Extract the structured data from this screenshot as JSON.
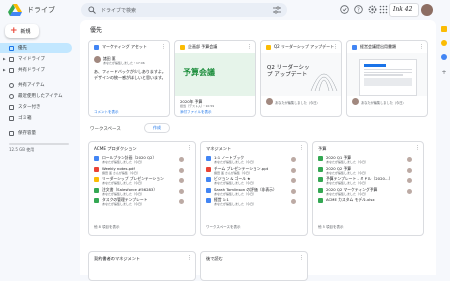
{
  "app": {
    "title": "ドライブ"
  },
  "search": {
    "placeholder": "ドライブで検索"
  },
  "org_label": "Ink 42",
  "new_button": {
    "label": "新規"
  },
  "nav": [
    {
      "label": "優先",
      "active": true
    },
    {
      "label": "マイドライブ",
      "caret": true
    },
    {
      "label": "共有ドライブ",
      "caret": true
    },
    {
      "label": "共有アイテム"
    },
    {
      "label": "最近使用したアイテム"
    },
    {
      "label": "スター付き"
    },
    {
      "label": "ゴミ箱"
    },
    {
      "label": "保存容量"
    }
  ],
  "storage": {
    "text": "12.5 GB 使用"
  },
  "priority": {
    "heading": "優先",
    "cards": [
      {
        "title": "マーケティング アセット",
        "icon_color": "#4285f4",
        "owner": "諸田 薫",
        "meta": "あなたが編集しました・17:06",
        "body": "あ、フィードバックが少しありますよ。デザインの統一感がほしいと思います。",
        "link": "コメントを表示"
      },
      {
        "title": "企画部 予算会議",
        "icon_color": "#fbbc04",
        "preview_title": "予算会議",
        "preview_sub": "2020年 予算",
        "owner": "予算会議",
        "meta": "担当（デスト入）・10:59",
        "link": "添付ファイルを表示"
      },
      {
        "title": "Q2 リーダーシップ アップデート",
        "icon_color": "#fbbc04",
        "preview_title": "Q2 リーダーシップ アップデート",
        "meta": "あなたが編集しました（今日）"
      },
      {
        "title": "経営会議提出用書類",
        "icon_color": "#4285f4",
        "meta": "あなたが編集しました（今日）"
      }
    ]
  },
  "workspace": {
    "label": "ワークスペース",
    "button": "作成"
  },
  "workspaces": [
    {
      "title": "ACME プロダクション",
      "files": [
        {
          "name": "ロールプラン計画（2020 Q2）",
          "meta": "あなたが編集しました（今日）",
          "color": "#4285f4"
        },
        {
          "name": "Weekly notes.pdf",
          "meta": "諸田 薫 さんが編集（今日）",
          "color": "#ea4335"
        },
        {
          "name": "リーダーシップ プレゼンテーション",
          "meta": "あなたが編集しました（今日）",
          "color": "#fbbc04"
        },
        {
          "name": "注文書（Salesforce #56283）",
          "meta": "あなたが編集しました（今日）",
          "color": "#34a853"
        },
        {
          "name": "タスクの管理テンプレート",
          "meta": "あなたが編集しました（今日）",
          "color": "#34a853"
        }
      ],
      "more": "他 8 項目を表示"
    },
    {
      "title": "マネジメント",
      "files": [
        {
          "name": "1:1 ノートブック",
          "meta": "あなたが編集しました（今日）",
          "color": "#4285f4"
        },
        {
          "name": "チーム プレゼンテーション.ppt",
          "meta": "諸田 薫 さんが編集（今日）",
          "color": "#ea4335"
        },
        {
          "name": "ビジョン & ゴール ★",
          "meta": "あなたが編集しました（今日）",
          "color": "#4285f4"
        },
        {
          "name": "Sarah Tomlinson の評価（非表示）",
          "meta": "あなたが編集しました（今日）",
          "color": "#4285f4"
        },
        {
          "name": "経営 1:1",
          "meta": "あなたが編集しました（今日）",
          "color": "#4285f4"
        }
      ],
      "more": "ワークスペースを表示"
    },
    {
      "title": "予算",
      "files": [
        {
          "name": "2020 Q1 予算",
          "meta": "あなたが編集しました（今日）",
          "color": "#34a853"
        },
        {
          "name": "2020 Q2 予算",
          "meta": "あなたが編集しました（今日）",
          "color": "#34a853"
        },
        {
          "name": "予算テンプレート - ミドル（2020…）",
          "meta": "あなたが編集しました（今日）",
          "color": "#34a853"
        },
        {
          "name": "2020 Q2 マーケティング予算",
          "meta": "あなたが編集しました（今日）",
          "color": "#34a853"
        },
        {
          "name": "ACME カスタム モデル.xlsx",
          "meta": "",
          "color": "#34a853"
        }
      ],
      "more": "他 5 項目を表示"
    }
  ],
  "bottom_cards": [
    {
      "title": "契約書者のマネジメント"
    },
    {
      "title": "後で読む"
    }
  ]
}
